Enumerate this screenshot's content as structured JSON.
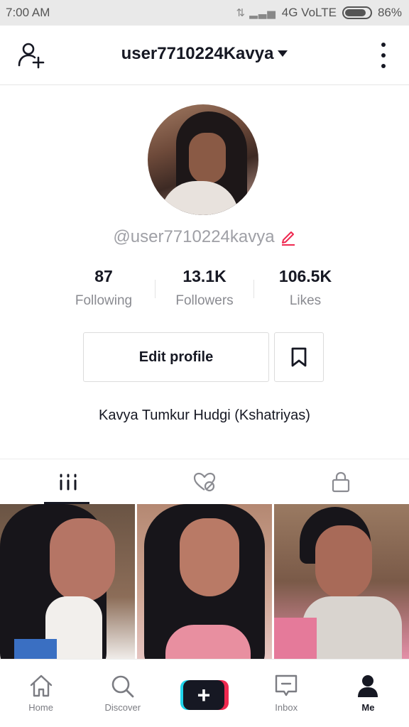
{
  "status_bar": {
    "time": "7:00 AM",
    "network": "4G VoLTE",
    "battery": "86%",
    "battery_level": 0.86
  },
  "header": {
    "username": "user7710224Kavya",
    "add_friend_icon": "add-user-icon",
    "more_icon": "more-vertical-icon"
  },
  "profile": {
    "handle": "@user7710224kavya",
    "stats": [
      {
        "value": "87",
        "label": "Following"
      },
      {
        "value": "13.1K",
        "label": "Followers"
      },
      {
        "value": "106.5K",
        "label": "Likes"
      }
    ],
    "edit_profile_label": "Edit profile",
    "bio": "Kavya Tumkur Hudgi (Kshatriyas)"
  },
  "tabs": [
    {
      "icon": "grid-icon",
      "active": true
    },
    {
      "icon": "liked-hidden-icon",
      "active": false
    },
    {
      "icon": "lock-icon",
      "active": false
    }
  ],
  "bottom_nav": [
    {
      "label": "Home",
      "icon": "home-icon"
    },
    {
      "label": "Discover",
      "icon": "search-icon"
    },
    {
      "label": "",
      "icon": "create-plus-icon"
    },
    {
      "label": "Inbox",
      "icon": "inbox-icon"
    },
    {
      "label": "Me",
      "icon": "profile-icon",
      "active": true
    }
  ],
  "colors": {
    "text": "#161823",
    "muted": "#8a8b91",
    "accent_red": "#ef2950",
    "accent_cyan": "#20d5ec"
  }
}
